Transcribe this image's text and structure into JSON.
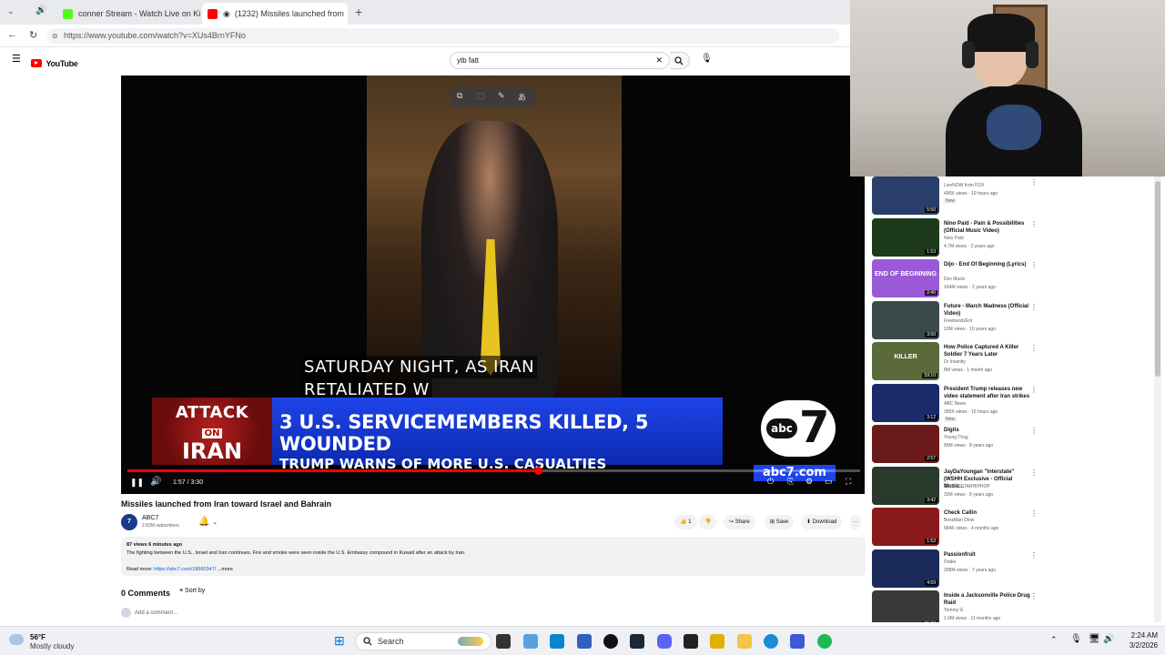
{
  "browser": {
    "tabs": [
      {
        "title": "conner Stream - Watch Live on Ki",
        "favicon_color": "#53fc18",
        "active": false
      },
      {
        "title": "(1232) Missiles launched from",
        "favicon_color": "#ff0000",
        "active": true
      }
    ],
    "new_tab_glyph": "+",
    "url": "https://www.youtube.com/watch?v=XUs4BrnYFNo"
  },
  "youtube": {
    "logo_text": "YouTube",
    "search_value": "ytb fatt",
    "player": {
      "caption_line1": "SATURDAY NIGHT, AS IRAN",
      "caption_line2": "RETALIATED W",
      "banner_attack": "ATTACK",
      "banner_on": "ON",
      "banner_iran": "IRAN",
      "headline": "3 U.S. SERVICEMEMBERS KILLED, 5 WOUNDED",
      "subheadline": "TRUMP WARNS OF MORE U.S. CASUALTIES",
      "station_abc": "abc",
      "station_num": "7",
      "station_url": "abc7.com",
      "time": "1:57 / 3:30",
      "progress_fraction": 0.56
    },
    "video_title": "Missiles launched from Iran toward Israel and Bahrain",
    "channel": {
      "name": "ABC7",
      "subscribers": "2.82M subscribers",
      "avatar_text": "7"
    },
    "actions": {
      "like": "1",
      "share": "Share",
      "save": "Save",
      "download": "Download",
      "more": "···"
    },
    "description": {
      "meta": "87 views  6 minutes ago",
      "text": "The fighting between the U.S., Israel and Iran continues. Fire and smoke were seen inside the U.S. Embassy compound in Kuwait after an attack by Iran.",
      "read_more_label": "Read more:",
      "link": "https://abc7.com/18660347/",
      "more": "...more"
    },
    "comments": {
      "title": "0 Comments",
      "sort": "Sort by",
      "placeholder": "Add a comment..."
    }
  },
  "sidebar": {
    "items": [
      {
        "title": "",
        "channel": "LiveNOW from FOX",
        "views": "490K views · 10 hours ago",
        "badge": "New",
        "duration": "5:50",
        "thumb": "#2a3e6a"
      },
      {
        "title": "Nino Paid - Pain & Possibilities (Official Music Video)",
        "channel": "Nino Paid",
        "views": "4.7M views · 2 years ago",
        "badge": "",
        "duration": "1:53",
        "thumb": "#1d3a1a"
      },
      {
        "title": "Dijo - End Of Beginning (Lyrics)",
        "channel": "Dex Music",
        "views": "164M views · 2 years ago",
        "badge": "",
        "duration": "2:40",
        "thumb": "#9a5ad8",
        "thumb_text": "END OF BEGINNING"
      },
      {
        "title": "Future - March Madness (Official Video)",
        "channel": "FreebandzEnt",
        "views": "12M views · 10 years ago",
        "badge": "",
        "duration": "3:00",
        "thumb": "#3a4a4a"
      },
      {
        "title": "How Police Captured A Killer Soldier 7 Years Later",
        "channel": "Dr Insanity",
        "views": "8M views · 1 month ago",
        "badge": "",
        "duration": "59:10",
        "thumb": "#5a6a3a",
        "thumb_text": "KILLER"
      },
      {
        "title": "President Trump releases new video statement after Iran strikes",
        "channel": "ABC News",
        "views": "355K views · 15 hours ago",
        "badge": "New",
        "duration": "3:12",
        "thumb": "#1a2a6a"
      },
      {
        "title": "Digits",
        "channel": "Young Thug",
        "views": "85M views · 8 years ago",
        "badge": "",
        "duration": "2:57",
        "thumb": "#6a1a1a"
      },
      {
        "title": "JayDaYoungan \"Interstate\" (WSHH Exclusive - Official Music...",
        "channel": "WORLDSTARHIPHOP",
        "views": "32M views · 8 years ago",
        "badge": "",
        "duration": "3:42",
        "thumb": "#2a3a2a"
      },
      {
        "title": "Check Callin",
        "channel": "BossMan Dlow",
        "views": "584K views · 4 months ago",
        "badge": "",
        "duration": "1:53",
        "thumb": "#8a1a1a"
      },
      {
        "title": "Passionfruit",
        "channel": "Drake",
        "views": "298M views · 7 years ago",
        "badge": "",
        "duration": "4:59",
        "thumb": "#1a2a5a"
      },
      {
        "title": "Inside a Jacksonville Police Drug Raid",
        "channel": "Tommy G",
        "views": "1.9M views · 11 months ago",
        "badge": "",
        "duration": "25:08",
        "thumb": "#3a3a3a"
      }
    ]
  },
  "taskbar": {
    "temp": "56°F",
    "condition": "Mostly cloudy",
    "search_label": "Search",
    "time": "2:24 AM",
    "date": "3/2/2026"
  }
}
